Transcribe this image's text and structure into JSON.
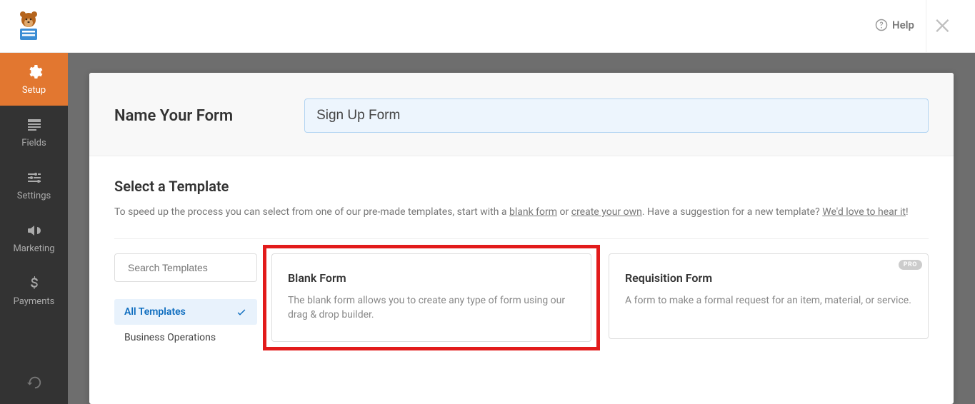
{
  "header": {
    "help_label": "Help"
  },
  "sidebar": {
    "items": [
      {
        "label": "Setup"
      },
      {
        "label": "Fields"
      },
      {
        "label": "Settings"
      },
      {
        "label": "Marketing"
      },
      {
        "label": "Payments"
      }
    ]
  },
  "name_section": {
    "label": "Name Your Form",
    "value": "Sign Up Form"
  },
  "template_section": {
    "heading": "Select a Template",
    "desc_pre": "To speed up the process you can select from one of our pre-made templates, start with a ",
    "link_blank": "blank form",
    "desc_or": " or ",
    "link_create": "create your own",
    "desc_mid": ". Have a suggestion for a new template? ",
    "link_hear": "We'd love to hear it",
    "desc_end": "!"
  },
  "search": {
    "placeholder": "Search Templates"
  },
  "categories": {
    "items": [
      {
        "label": "All Templates"
      },
      {
        "label": "Business Operations"
      }
    ]
  },
  "cards": {
    "blank": {
      "title": "Blank Form",
      "desc": "The blank form allows you to create any type of form using our drag & drop builder."
    },
    "requisition": {
      "title": "Requisition Form",
      "desc": "A form to make a formal request for an item, material, or service.",
      "badge": "PRO"
    }
  }
}
